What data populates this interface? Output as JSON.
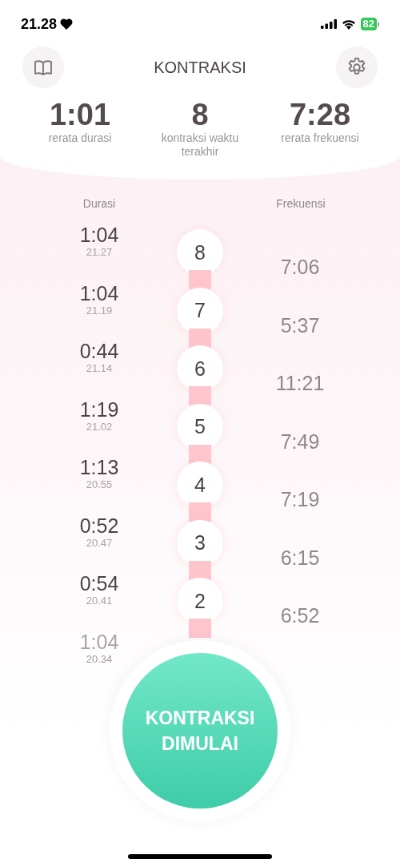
{
  "status_bar": {
    "time": "21.28",
    "battery": "82"
  },
  "header": {
    "title": "KONTRAKSI"
  },
  "summary": [
    {
      "value": "1:01",
      "label": "rerata durasi"
    },
    {
      "value": "8",
      "label": "kontraksi waktu terakhir"
    },
    {
      "value": "7:28",
      "label": "rerata frekuensi"
    }
  ],
  "columns": {
    "duration": "Durasi",
    "frequency": "Frekuensi"
  },
  "contractions": [
    {
      "number": "8",
      "duration": "1:04",
      "time": "21.27",
      "frequency": "7:06"
    },
    {
      "number": "7",
      "duration": "1:04",
      "time": "21.19",
      "frequency": "5:37"
    },
    {
      "number": "6",
      "duration": "0:44",
      "time": "21.14",
      "frequency": "11:21"
    },
    {
      "number": "5",
      "duration": "1:19",
      "time": "21.02",
      "frequency": "7:49"
    },
    {
      "number": "4",
      "duration": "1:13",
      "time": "20.55",
      "frequency": "7:19"
    },
    {
      "number": "3",
      "duration": "0:52",
      "time": "20.47",
      "frequency": "6:15"
    },
    {
      "number": "2",
      "duration": "0:54",
      "time": "20.41",
      "frequency": "6:52"
    },
    {
      "duration": "1:04",
      "time": "20.34"
    }
  ],
  "start_button": {
    "label": "KONTRAKSI DIMULAI"
  }
}
